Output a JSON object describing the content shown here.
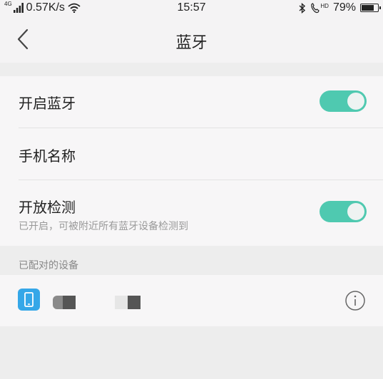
{
  "status_bar": {
    "network_type": "4G",
    "speed": "0.57K/s",
    "time": "15:57",
    "hd_label": "HD",
    "battery_text": "79%",
    "battery_level": 0.79,
    "icons": [
      "signal-icon",
      "wifi-icon",
      "bluetooth-icon",
      "hd-call-icon",
      "battery-icon"
    ]
  },
  "header": {
    "title": "蓝牙",
    "back_icon": "chevron-left-icon"
  },
  "settings": {
    "bluetooth_toggle": {
      "label": "开启蓝牙",
      "on": true
    },
    "phone_name": {
      "label": "手机名称"
    },
    "visibility": {
      "label": "开放检测",
      "subtitle": "已开启，可被附近所有蓝牙设备检测到",
      "on": true
    }
  },
  "paired": {
    "header": "已配对的设备",
    "device_icon": "phone-icon",
    "info_icon": "info-icon"
  },
  "colors": {
    "accent": "#4fc9b0",
    "device_icon_bg": "#35a7e8",
    "background": "#ededed",
    "card": "#f7f6f7"
  }
}
